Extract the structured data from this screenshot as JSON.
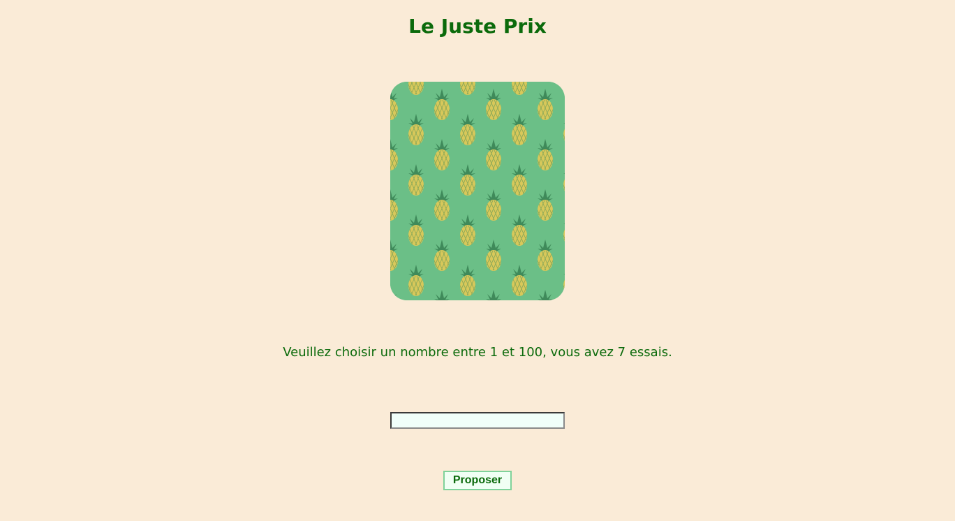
{
  "page": {
    "title": "Le Juste Prix",
    "background_color": "#faebd7",
    "text_color": "#0b6a0b"
  },
  "card": {
    "image": "pineapple-pattern",
    "pattern_background_color": "#6bbf87",
    "pineapple_color": "#d8c85a",
    "leaf_color": "#3f8a5a"
  },
  "game": {
    "instruction": "Veuillez choisir un nombre entre 1 et 100, vous avez 7 essais.",
    "guess_value": "",
    "guess_placeholder": ""
  },
  "actions": {
    "submit_label": "Proposer"
  }
}
